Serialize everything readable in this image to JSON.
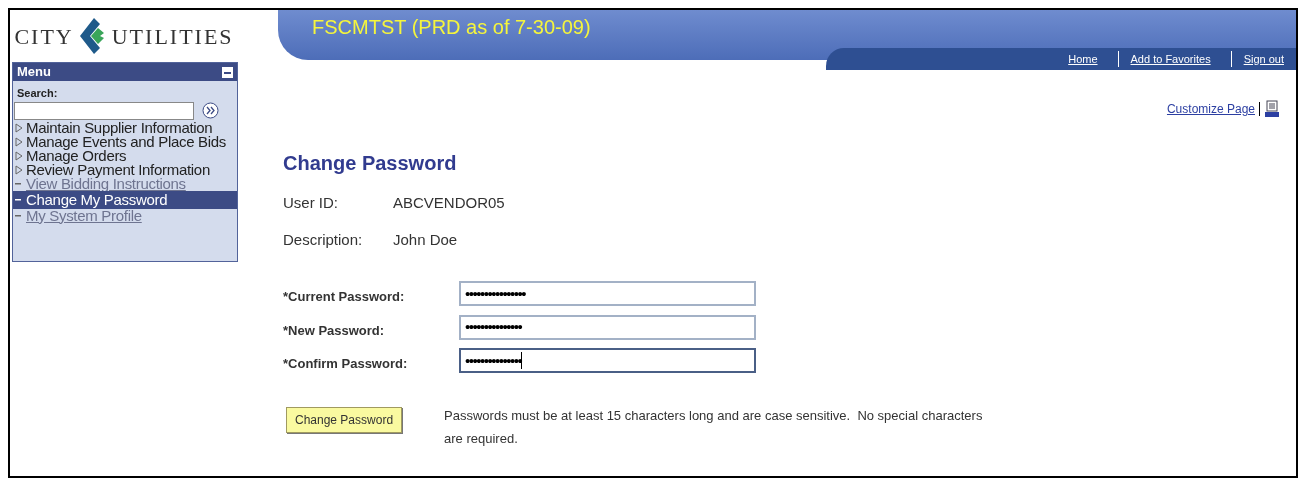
{
  "logo": {
    "left": "CITY",
    "right": "UTILITIES"
  },
  "banner": {
    "title": "FSCMTST (PRD as of 7-30-09)",
    "links": [
      "Home",
      "Add to Favorites",
      "Sign out"
    ]
  },
  "menu": {
    "title": "Menu",
    "search_label": "Search:",
    "items": [
      {
        "kind": "folder",
        "label": "Maintain Supplier Information",
        "selected": false
      },
      {
        "kind": "folder",
        "label": "Manage Events and Place Bids",
        "selected": false
      },
      {
        "kind": "folder",
        "label": "Manage Orders",
        "selected": false
      },
      {
        "kind": "folder",
        "label": "Review Payment Information",
        "selected": false
      },
      {
        "kind": "link",
        "label": "View Bidding Instructions",
        "selected": false
      },
      {
        "kind": "link",
        "label": "Change My Password",
        "selected": true
      },
      {
        "kind": "link",
        "label": "My System Profile",
        "selected": false
      }
    ]
  },
  "customize_link": "Customize Page",
  "page_title": "Change Password",
  "info": [
    {
      "label": "User ID:",
      "value": "ABCVENDOR05"
    },
    {
      "label": "Description:",
      "value": "John Doe"
    }
  ],
  "fields": [
    {
      "label": "*Current Password:",
      "value": "••••••••••••••••",
      "focused": false
    },
    {
      "label": "*New Password:",
      "value": "•••••••••••••••",
      "focused": false
    },
    {
      "label": "*Confirm Password:",
      "value": "•••••••••••••••",
      "focused": true
    }
  ],
  "submit": "Change Password",
  "note": "Passwords must be at least 15 characters long and are case sensitive.  No special characters are required."
}
